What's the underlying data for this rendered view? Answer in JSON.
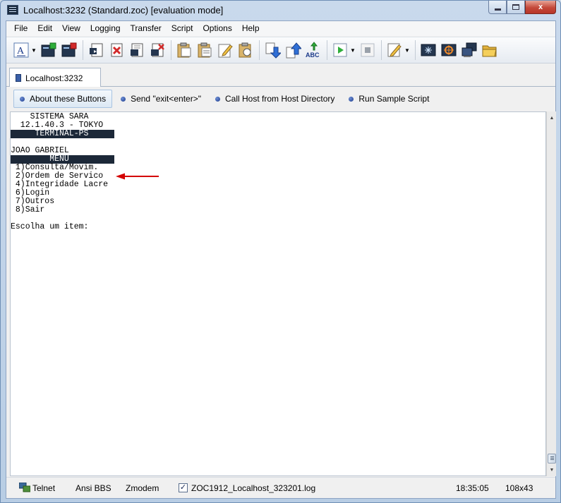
{
  "window": {
    "title": "Localhost:3232 (Standard.zoc) [evaluation mode]",
    "controls": {
      "minimize": "minimize",
      "maximize": "maximize",
      "close": "x"
    }
  },
  "menu": [
    "File",
    "Edit",
    "View",
    "Logging",
    "Transfer",
    "Script",
    "Options",
    "Help"
  ],
  "tab": {
    "label": "Localhost:3232"
  },
  "buttons": [
    {
      "label": "About these Buttons"
    },
    {
      "label": "Send \"exit<enter>\""
    },
    {
      "label": "Call Host from Host Directory"
    },
    {
      "label": "Run Sample Script"
    }
  ],
  "terminal": {
    "lines": [
      "    SISTEMA SARA",
      "  12.1.40.3 - TOKYO",
      "     TERMINAL-PS",
      "",
      "JOAO GABRIEL",
      "        MENU",
      " 1)Consulta/Movim.",
      " 2)Ordem de Servico",
      " 4)Integridade Lacre",
      " 6)Login",
      " 7)Outros",
      " 8)Sair",
      "",
      "Escolha um item:"
    ],
    "inverse_lines": [
      2,
      5
    ]
  },
  "status": {
    "protocol": "Telnet",
    "emulation": "Ansi BBS",
    "transfer": "Zmodem",
    "log_checked": true,
    "log_file": "ZOC1912_Localhost_323201.log",
    "time": "18:35:05",
    "size": "108x43"
  },
  "colors": {
    "terminal_bg": "#ffffff",
    "terminal_inverse": "#1c2838",
    "annotation_arrow": "#d40000"
  }
}
